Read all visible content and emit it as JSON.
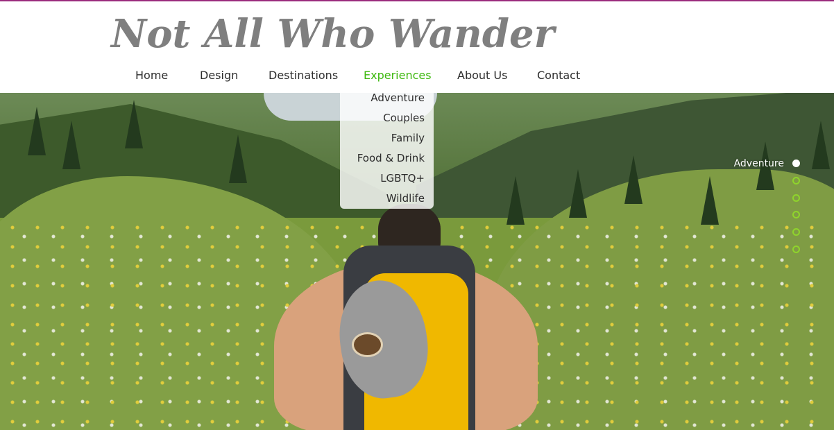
{
  "site": {
    "logo_text": "Not All Who Wander"
  },
  "nav": {
    "items": [
      {
        "label": "Home"
      },
      {
        "label": "Design"
      },
      {
        "label": "Destinations"
      },
      {
        "label": "Experiences"
      },
      {
        "label": "About Us"
      },
      {
        "label": "Contact"
      }
    ],
    "active": "Experiences"
  },
  "dropdown": {
    "items": [
      {
        "label": "Adventure"
      },
      {
        "label": "Couples"
      },
      {
        "label": "Family"
      },
      {
        "label": "Food & Drink"
      },
      {
        "label": "LGBTQ+"
      },
      {
        "label": "Wildlife"
      }
    ]
  },
  "slideshow": {
    "current_label": "Adventure",
    "dot_count": 6,
    "active_index": 0
  },
  "colors": {
    "accent_green": "#3db80e",
    "dot_green": "#8fd42c",
    "top_line": "#9b2c7d",
    "logo_gray": "#7f7f7f"
  }
}
